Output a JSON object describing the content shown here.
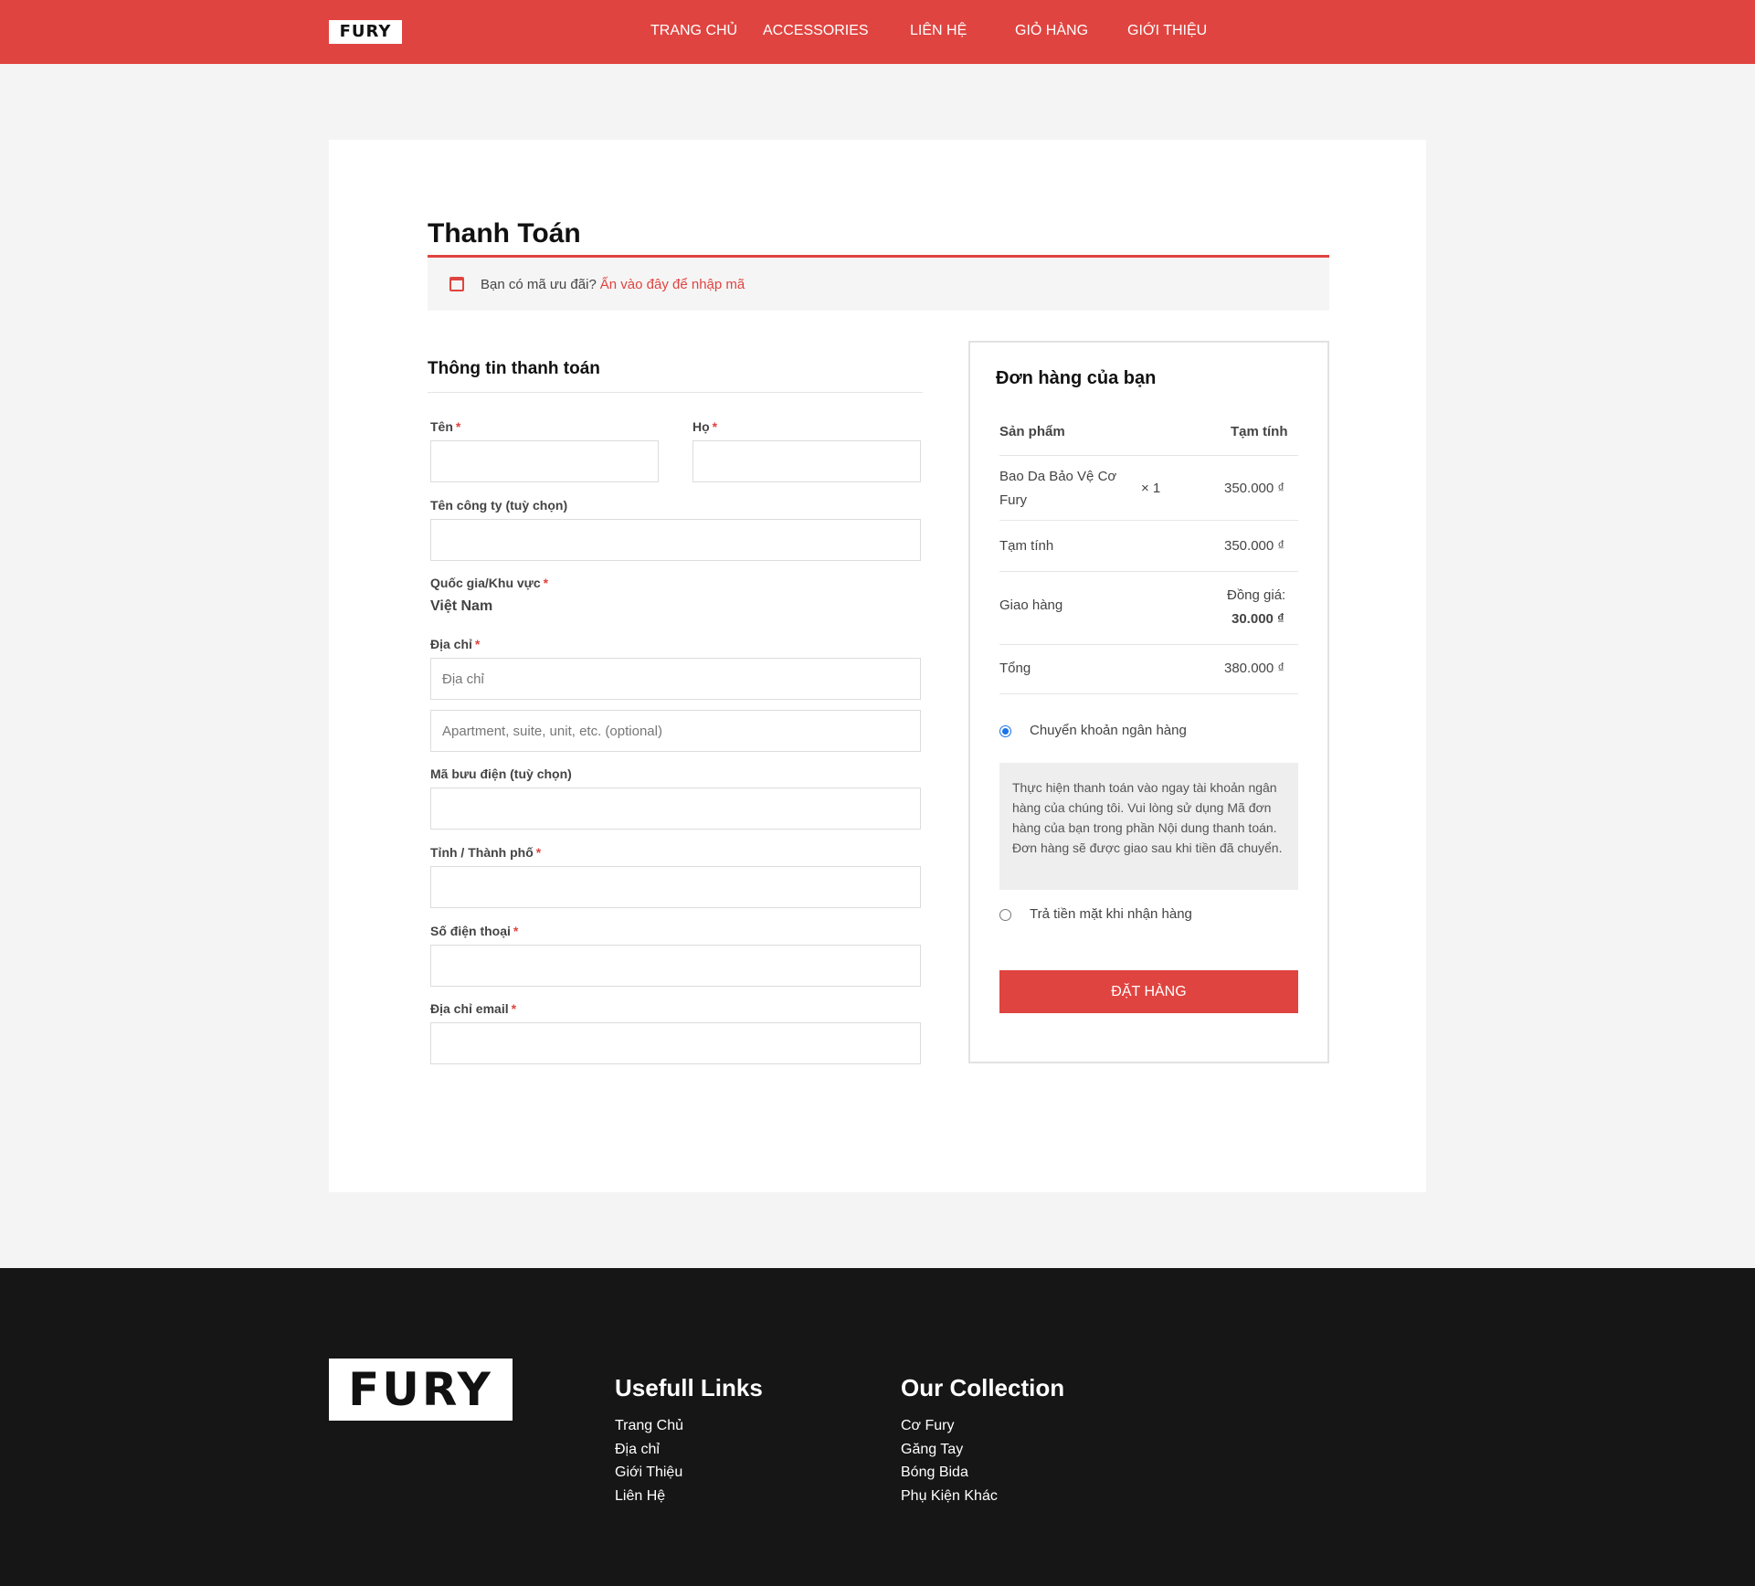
{
  "brand": {
    "logo_text": "FURY"
  },
  "nav": [
    "TRANG CHỦ",
    "ACCESSORIES",
    "LIÊN HỆ",
    "GIỎ HÀNG",
    "GIỚI THIỆU"
  ],
  "page": {
    "title": "Thanh Toán",
    "coupon_prompt": "Bạn có mã ưu đãi?",
    "coupon_link": "Ấn vào đây để nhập mã"
  },
  "billing": {
    "heading": "Thông tin thanh toán",
    "required_mark": "*",
    "first_name_label": "Tên",
    "last_name_label": "Họ",
    "company_label": "Tên công ty (tuỳ chọn)",
    "country_label": "Quốc gia/Khu vực",
    "country_value": "Việt Nam",
    "address_label": "Địa chỉ",
    "address_placeholder": "Địa chỉ",
    "address2_placeholder": "Apartment, suite, unit, etc. (optional)",
    "postcode_label": "Mã bưu điện (tuỳ chọn)",
    "city_label": "Tỉnh / Thành phố",
    "phone_label": "Số điện thoại",
    "email_label": "Địa chỉ email"
  },
  "order": {
    "heading": "Đơn hàng của bạn",
    "col_product": "Sản phẩm",
    "col_subtotal": "Tạm tính",
    "items": [
      {
        "name_line1": "Bao Da Bảo Vệ Cơ",
        "name_line2": "Fury",
        "qty": "× 1",
        "price": "350.000 ₫"
      }
    ],
    "subtotal_label": "Tạm tính",
    "subtotal_value": "350.000 ₫",
    "shipping_label": "Giao hàng",
    "shipping_method": "Đồng giá:",
    "shipping_value": "30.000 ₫",
    "total_label": "Tổng",
    "total_value": "380.000 ₫",
    "payment_bank": "Chuyển khoản ngân hàng",
    "payment_bank_selected": true,
    "bank_description": "Thực hiện thanh toán vào ngay tài khoản ngân hàng của chúng tôi. Vui lòng sử dụng Mã đơn hàng của bạn trong phần Nội dung thanh toán. Đơn hàng sẽ được giao sau khi tiền đã chuyển.",
    "payment_cod": "Trả tiền mặt khi nhận hàng",
    "place_order": "ĐẶT HÀNG"
  },
  "footer": {
    "links_heading": "Usefull Links",
    "links": [
      "Trang Chủ",
      "Địa chỉ",
      "Giới Thiệu",
      "Liên Hệ"
    ],
    "collection_heading": "Our Collection",
    "collection": [
      "Cơ Fury",
      "Găng Tay",
      "Bóng Bida",
      "Phụ Kiện Khác"
    ]
  },
  "colors": {
    "accent": "#e04440",
    "footer_bg": "#161616",
    "page_bg": "#f4f4f4"
  }
}
